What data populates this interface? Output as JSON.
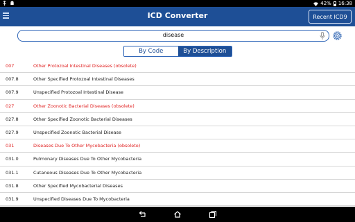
{
  "status_bar": {
    "battery": "42%",
    "time": "16:38"
  },
  "action_bar": {
    "title": "ICD Converter",
    "recent_button": "Recent ICD9",
    "colors": {
      "bar": "#1e4f96",
      "accent": "#2f66b8"
    }
  },
  "search": {
    "value": "disease"
  },
  "tabs": [
    {
      "label": "By Code",
      "active": false
    },
    {
      "label": "By Description",
      "active": true
    }
  ],
  "results": [
    {
      "code": "007",
      "description": "Other Protozoal Intestinal Diseases  (obsolete)",
      "obsolete": true
    },
    {
      "code": "007.8",
      "description": "Other Specified Protozoal Intestinal Diseases",
      "obsolete": false
    },
    {
      "code": "007.9",
      "description": "Unspecified Protozoal Intestinal Disease",
      "obsolete": false
    },
    {
      "code": "027",
      "description": "Other Zoonotic Bacterial Diseases  (obsolete)",
      "obsolete": true
    },
    {
      "code": "027.8",
      "description": "Other Specified Zoonotic Bacterial Diseases",
      "obsolete": false
    },
    {
      "code": "027.9",
      "description": "Unspecified Zoonotic Bacterial Disease",
      "obsolete": false
    },
    {
      "code": "031",
      "description": "Diseases Due To Other Mycobacteria  (obsolete)",
      "obsolete": true
    },
    {
      "code": "031.0",
      "description": "Pulmonary Diseases Due To Other Mycobacteria",
      "obsolete": false
    },
    {
      "code": "031.1",
      "description": "Cutaneous Diseases Due To Other Mycobacteria",
      "obsolete": false
    },
    {
      "code": "031.8",
      "description": "Other Specified Mycobacterial Diseases",
      "obsolete": false
    },
    {
      "code": "031.9",
      "description": "Unspecified Diseases Due To Mycobacteria",
      "obsolete": false
    }
  ]
}
